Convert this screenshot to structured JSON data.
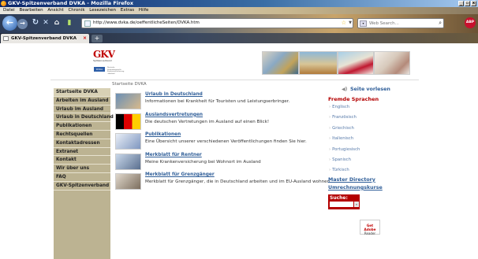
{
  "window": {
    "title": "GKV-Spitzenverband DVKA - Mozilla Firefox",
    "controls": [
      "_",
      "▫",
      "x"
    ]
  },
  "menu": [
    "Datei",
    "Bearbeiten",
    "Ansicht",
    "Chronik",
    "Lesezeichen",
    "Extras",
    "Hilfe"
  ],
  "toolbar": {
    "url": "http://www.dvka.de/oeffentlicheSeiten/DVKA.htm",
    "search_placeholder": "Web Search...",
    "adblock": "ABP"
  },
  "tabs": [
    {
      "label": "GKV-Spitzenverband DVKA"
    }
  ],
  "newtab_label": "+",
  "site": {
    "logo_mark": "GKV",
    "logo_text": "Spitzenverband",
    "logo_badge": "DVKA",
    "logo_small": "Deutsche Verbindungsstelle Krankenversicherung - Ausland",
    "breadcrumb": "Startseite DVKA",
    "nav": [
      "Startseite DVKA",
      "Arbeiten im Ausland",
      "Urlaub im Ausland",
      "Urlaub in Deutschland",
      "Publikationen",
      "Rechtsquellen",
      "Kontaktadressen",
      "Extranet",
      "Kontakt",
      "Wir über uns",
      "FAQ",
      "GKV-Spitzenverband"
    ],
    "entries": [
      {
        "title": "Urlaub in Deutschland",
        "desc": "Informationen bei Krankheit für Touristen und Leistungserbringer."
      },
      {
        "title": "Auslandsvertretungen",
        "desc": "Die deutschen Vertretungen im Ausland auf einen Blick!"
      },
      {
        "title": "Publikationen",
        "desc": "Eine Übersicht unserer verschiedenen Veröffentlichungen finden Sie hier."
      },
      {
        "title": "Merkblatt für Rentner",
        "desc": "Meine Krankenversicherung bei Wohnort im Ausland"
      },
      {
        "title": "Merkblatt für Grenzgänger",
        "desc": "Merkblatt für Grenzgänger, die in Deutschland arbeiten und im EU-Ausland wohnen"
      }
    ],
    "read_aloud": "Seite vorlesen",
    "languages_heading": "Fremde Sprachen",
    "languages": [
      "Englisch",
      "Französisch",
      "Griechisch",
      "Italienisch",
      "Portugiesisch",
      "Spanisch",
      "Türkisch"
    ],
    "master_directory": "Master Directory",
    "currency": "Umrechnungskurse",
    "search_label": "Suche:",
    "search_go": "»",
    "reader": {
      "line1": "Get Adobe",
      "line2": "Reader"
    }
  }
}
